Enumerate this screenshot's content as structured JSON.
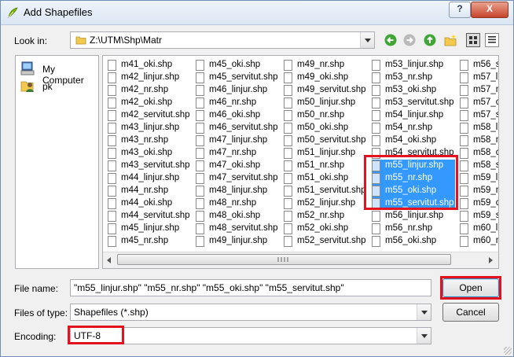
{
  "window": {
    "title": "Add Shapefiles",
    "help_label": "?",
    "close_label": "X"
  },
  "look_in": {
    "label": "Look in:",
    "path": "Z:\\UTM\\Shp\\Matr"
  },
  "toolbar": {
    "icons": [
      "back-icon",
      "forward-icon",
      "parent-directory-icon",
      "new-folder-icon",
      "icon-view-icon",
      "detail-view-icon"
    ]
  },
  "sidebar": {
    "items": [
      {
        "label": "My Computer",
        "icon": "computer-icon"
      },
      {
        "label": "pk",
        "icon": "user-folder-icon"
      }
    ]
  },
  "files": {
    "columns": [
      [
        "m41_oki.shp",
        "m42_linjur.shp",
        "m42_nr.shp",
        "m42_oki.shp",
        "m42_servitut.shp",
        "m43_linjur.shp",
        "m43_nr.shp",
        "m43_oki.shp",
        "m43_servitut.shp",
        "m44_linjur.shp",
        "m44_nr.shp",
        "m44_oki.shp",
        "m44_servitut.shp",
        "m45_linjur.shp",
        "m45_nr.shp"
      ],
      [
        "m45_oki.shp",
        "m45_servitut.shp",
        "m46_linjur.shp",
        "m46_nr.shp",
        "m46_oki.shp",
        "m46_servitut.shp",
        "m47_linjur.shp",
        "m47_nr.shp",
        "m47_oki.shp",
        "m47_servitut.shp",
        "m48_linjur.shp",
        "m48_nr.shp",
        "m48_oki.shp",
        "m48_servitut.shp",
        "m49_linjur.shp"
      ],
      [
        "m49_nr.shp",
        "m49_oki.shp",
        "m49_servitut.shp",
        "m50_linjur.shp",
        "m50_nr.shp",
        "m50_oki.shp",
        "m50_servitut.shp",
        "m51_linjur.shp",
        "m51_nr.shp",
        "m51_oki.shp",
        "m51_servitut.shp",
        "m52_linjur.shp",
        "m52_nr.shp",
        "m52_oki.shp",
        "m52_servitut.shp"
      ],
      [
        "m53_linjur.shp",
        "m53_nr.shp",
        "m53_oki.shp",
        "m53_servitut.shp",
        "m54_linjur.shp",
        "m54_nr.shp",
        "m54_oki.shp",
        "m54_servitut.shp",
        "m55_linjur.shp",
        "m55_nr.shp",
        "m55_oki.shp",
        "m55_servitut.shp",
        "m56_linjur.shp",
        "m56_nr.shp",
        "m56_oki.shp"
      ],
      [
        "m56_s",
        "m57_li",
        "m57_n",
        "m57_c",
        "m57_s",
        "m58_li",
        "m58_n",
        "m58_c",
        "m58_s",
        "m59_li",
        "m59_n",
        "m59_c",
        "m59_s",
        "m60_li",
        "m60_n"
      ]
    ],
    "selected": [
      "m55_linjur.shp",
      "m55_nr.shp",
      "m55_oki.shp",
      "m55_servitut.shp"
    ]
  },
  "file_name": {
    "label": "File name:",
    "value": "\"m55_linjur.shp\" \"m55_nr.shp\" \"m55_oki.shp\" \"m55_servitut.shp\""
  },
  "files_of_type": {
    "label": "Files of type:",
    "value": "Shapefiles (*.shp)"
  },
  "encoding": {
    "label": "Encoding:",
    "value": "UTF-8"
  },
  "buttons": {
    "open": "Open",
    "cancel": "Cancel"
  },
  "colors": {
    "selection": "#3399ff",
    "highlight_box": "#e3121e"
  }
}
